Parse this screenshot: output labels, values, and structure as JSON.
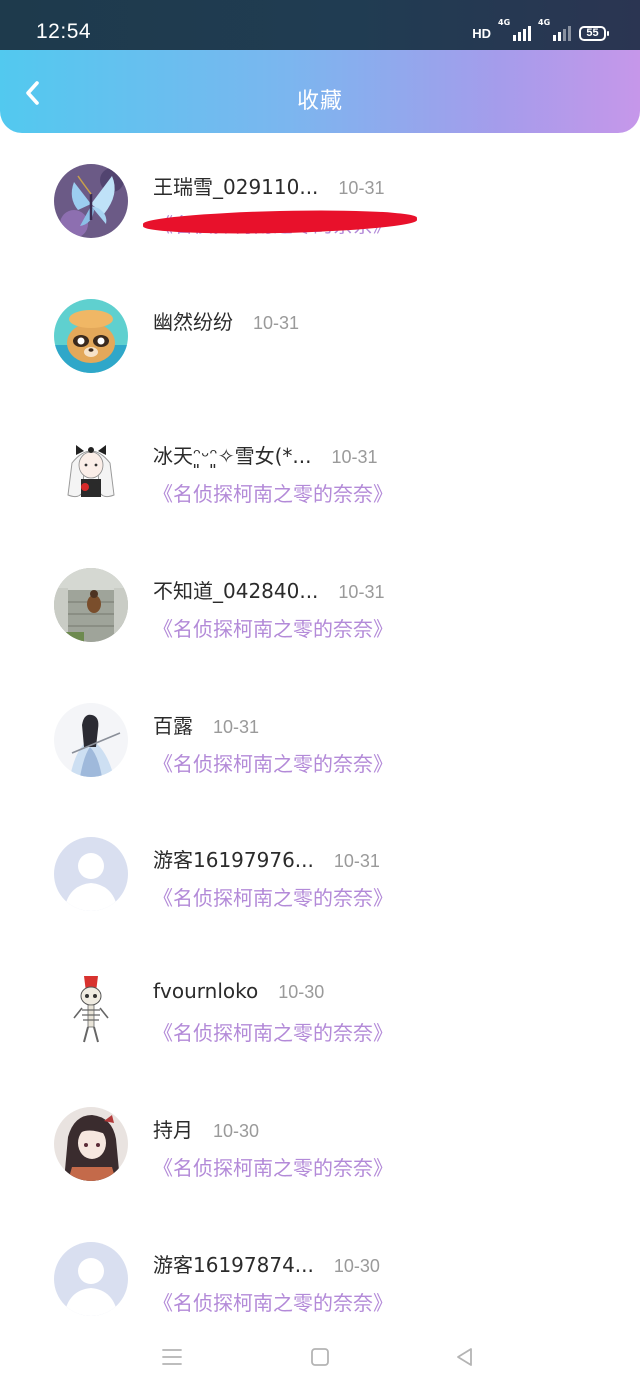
{
  "status_bar": {
    "time": "12:54",
    "hd_label": "HD",
    "network_1": "4G",
    "network_2": "4G",
    "battery": "55"
  },
  "header": {
    "title": "收藏",
    "back_icon": "chevron-left-icon"
  },
  "favorites": [
    {
      "name": "王瑞雪_029110...",
      "date": "10-31",
      "work": "《名侦探柯南之零的奈奈》",
      "avatar": "butterfly"
    },
    {
      "name": "幽然纷纷",
      "date": "10-31",
      "work": "",
      "avatar": "cartoon-raccoon",
      "redacted": true
    },
    {
      "name": "冰天ᵔ͈ᵕᵔ͈✧雪女(*...",
      "date": "10-31",
      "work": "《名侦探柯南之零的奈奈》",
      "avatar": "anime-girl-bow"
    },
    {
      "name": "不知道_042840...",
      "date": "10-31",
      "work": "《名侦探柯南之零的奈奈》",
      "avatar": "stairway-photo"
    },
    {
      "name": "百露",
      "date": "10-31",
      "work": "《名侦探柯南之零的奈奈》",
      "avatar": "swordsman-illustration"
    },
    {
      "name": "游客16197976...",
      "date": "10-31",
      "work": "《名侦探柯南之零的奈奈》",
      "avatar": "default-user"
    },
    {
      "name": "fvournloko",
      "date": "10-30",
      "work": "《名侦探柯南之零的奈奈》",
      "avatar": "skeleton-cartoon"
    },
    {
      "name": "持月",
      "date": "10-30",
      "work": "《名侦探柯南之零的奈奈》",
      "avatar": "anime-girl-dark-hair"
    },
    {
      "name": "游客16197874...",
      "date": "10-30",
      "work": "《名侦探柯南之零的奈奈》",
      "avatar": "default-user"
    }
  ],
  "colors": {
    "header_gradient": [
      "#52c9ef",
      "#c697ea"
    ],
    "work_title": "#b38ad8",
    "date": "#9a9a9a",
    "redaction": "#e8112b"
  },
  "nav_bar": {
    "menu_icon": "menu-icon",
    "home_icon": "home-square-icon",
    "back_icon": "back-triangle-icon"
  }
}
